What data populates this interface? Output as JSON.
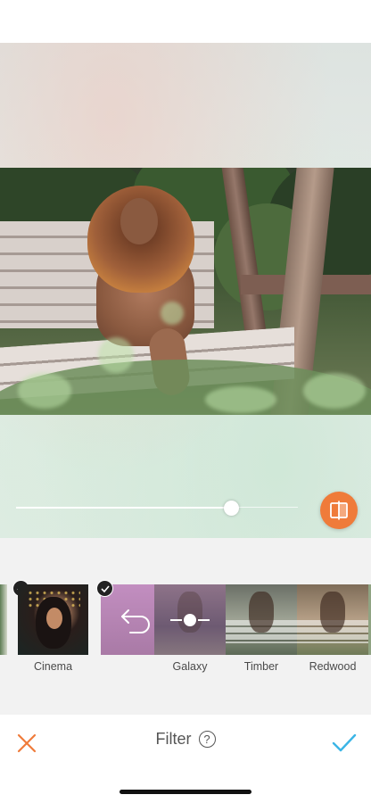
{
  "editor": {
    "title": "Filter",
    "help_glyph": "?",
    "intensity_percent": 80
  },
  "filters": [
    {
      "label": "",
      "selected": false
    },
    {
      "label": "Cinema",
      "selected": true
    },
    {
      "label": "",
      "selected": true
    },
    {
      "label": "Galaxy",
      "selected": false
    },
    {
      "label": "Timber",
      "selected": false
    },
    {
      "label": "Redwood",
      "selected": false
    }
  ],
  "colors": {
    "accent_orange": "#EF7B3A",
    "confirm_blue": "#3BB5E6"
  },
  "icons": {
    "compare": "compare-split-icon",
    "undo": "undo-arrow-icon",
    "cancel": "close-icon",
    "confirm": "checkmark-icon",
    "help": "help-circle-icon",
    "adjust": "slider-adjust-icon"
  }
}
